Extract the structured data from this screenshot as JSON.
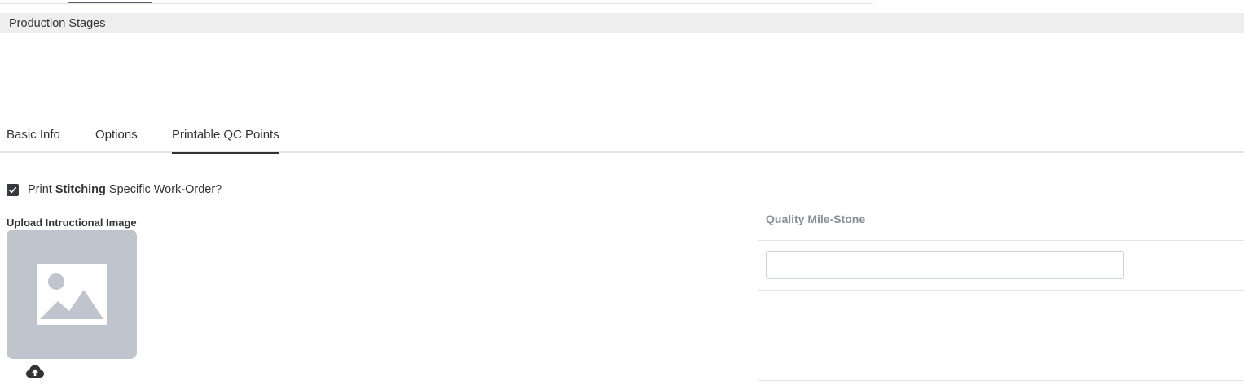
{
  "section": {
    "title": "Production Stages"
  },
  "tabs": [
    {
      "label": "Basic Info",
      "active": false
    },
    {
      "label": "Options",
      "active": false
    },
    {
      "label": "Printable QC Points",
      "active": true
    }
  ],
  "print_option": {
    "checked": true,
    "prefix": "Print",
    "bold": "Stitching",
    "suffix": "Specific Work-Order?"
  },
  "upload": {
    "label": "Upload Intructional Image",
    "placeholder_icon": "image-icon",
    "action_icon": "cloud-upload-icon"
  },
  "qc_table": {
    "header": "Quality Mile-Stone",
    "rows": [
      {
        "value": ""
      }
    ]
  },
  "colors": {
    "header_bg": "#eeeeee",
    "checkbox": "#343a40",
    "placeholder_bg": "#c0c4cc",
    "muted_header": "#8a8f96"
  }
}
